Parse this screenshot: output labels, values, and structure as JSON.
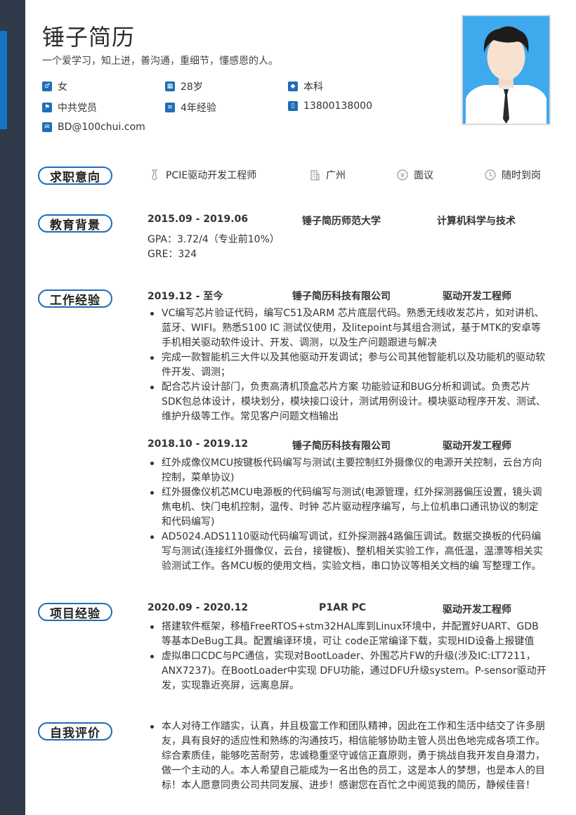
{
  "header": {
    "name": "锤子简历",
    "motto": "一个爱学习，知上进，善沟通，重细节，懂感恩的人。"
  },
  "info": {
    "gender": "女",
    "age": "28岁",
    "degree": "本科",
    "politics": "中共党员",
    "experience": "4年经验",
    "phone": "13800138000",
    "email": "BD@100chui.com"
  },
  "sections": {
    "intent": "求职意向",
    "education": "教育背景",
    "work": "工作经验",
    "project": "项目经验",
    "self": "自我评价"
  },
  "intent": {
    "position": "PCIE驱动开发工程师",
    "city": "广州",
    "salary": "面议",
    "availability": "随时到岗"
  },
  "education": {
    "period": "2015.09 - 2019.06",
    "school": "锤子简历师范大学",
    "major": "计算机科学与技术",
    "gpa": "GPA：3.72/4（专业前10%）",
    "gre": "GRE：324"
  },
  "work": [
    {
      "period": "2019.12 - 至今",
      "company": "锤子简历科技有限公司",
      "role": "驱动开发工程师",
      "items": [
        "VC编写芯片验证代码，编写C51及ARM 芯片底层代码。熟悉无线收发芯片，如对讲机、蓝牙、WIFI。熟悉S100 IC 测试仪使用，及litepoint与其组合测试，基于MTK的安卓等手机相关驱动软件设计、开发、调测，以及生产问题跟进与解决",
        "完成一款智能机三大件以及其他驱动开发调试；参与公司其他智能机以及功能机的驱动软件开发、调测；",
        "配合芯片设计部门，负责高清机顶盒芯片方案 功能验证和BUG分析和调试。负责芯片SDK包总体设计，模块划分，模块接口设计，测试用例设计。模块驱动程序开发、测试、维护升级等工作。常见客户问题文档输出"
      ]
    },
    {
      "period": "2018.10 - 2019.12",
      "company": "锤子简历科技有限公司",
      "role": "驱动开发工程师",
      "items": [
        "红外成像仪MCU按键板代码编写与测试(主要控制红外摄像仪的电源开关控制，云台方向控制，菜单协议)",
        "红外摄像仪机芯MCU电源板的代码编写与测试(电源管理，红外探测器偏压设置，镜头调焦电机、快门电机控制，温传、时钟 芯片驱动程序编写，与上位机串口通讯协议的制定和代码编写)",
        "AD5024.ADS1110驱动代码编写调试，红外探测器4路偏压调试。数据交换板的代码编写与测试(连接红外摄像仪，云台，接键板)、整机相关实验工作，高低温，温漂等相关实验测试工作。各MCU板的使用文档，实验文档，串口协议等相关文档的编 写整理工作。"
      ]
    }
  ],
  "project": {
    "period": "2020.09 - 2020.12",
    "name": "P1AR PC",
    "role": "驱动开发工程师",
    "items": [
      "搭建软件框架，移植FreeRTOS+stm32HAL库到Linux环境中，并配置好UART、GDB等基本DeBug工具。配置编译环境，可让 code正常编译下载，实现HID设备上报键值",
      "虚拟串口CDC与PC通信，实现对BootLoader、外围芯片FW的升级(涉及IC:LT7211，ANX7237)。在BootLoader中实现 DFU功能，通过DFU升级system。P-sensor驱动开发，实现靠近亮屏，远离息屏。"
    ]
  },
  "self_eval": {
    "items": [
      "本人对待工作踏实，认真，并且极富工作和团队精神，因此在工作和生活中结交了许多朋友，具有良好的适应性和熟练的沟通技巧，相信能够协助主管人员出色地完成各项工作。综合素质佳，能够吃苦耐劳，忠诚稳重坚守诚信正直原则，勇于挑战自我开发自身潜力，做一个主动的人。本人希望自己能成为一名出色的员工，这是本人的梦想，也是本人的目标！本人愿意同贵公司共同发展、进步！感谢您在百忙之中阅览我的简历，静候佳音！"
    ]
  },
  "colors": {
    "accent": "#1e6db8",
    "sidebar": "#2f3a4b"
  }
}
